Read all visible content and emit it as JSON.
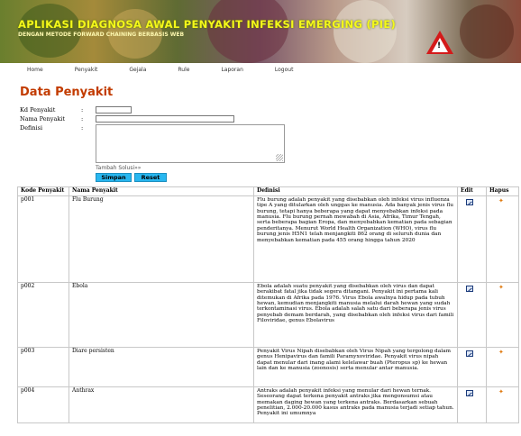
{
  "banner": {
    "title": "APLIKASI DIAGNOSA AWAL PENYAKIT INFEKSI EMERGING (PIE)",
    "subtitle": "DENGAN METODE FORWARD CHAINING BERBASIS WEB"
  },
  "nav": [
    {
      "label": "Home"
    },
    {
      "label": "Penyakit"
    },
    {
      "label": "Gejala"
    },
    {
      "label": "Rule"
    },
    {
      "label": "Laporan"
    },
    {
      "label": "Logout"
    }
  ],
  "page_title": "Data Penyakit",
  "form": {
    "kd_label": "Kd Penyakit",
    "nama_label": "Nama Penyakit",
    "definisi_label": "Definisi",
    "colon": ":",
    "kd_value": "",
    "nama_value": "",
    "definisi_value": "",
    "tambah_solusi": "Tambah Solusi»»",
    "simpan": "Simpan",
    "reset": "Reset"
  },
  "table": {
    "headers": {
      "kode": "Kode Penyakit",
      "nama": "Nama Penyakit",
      "definisi": "Definisi",
      "edit": "Edit",
      "hapus": "Hapus"
    },
    "rows": [
      {
        "kode": "p001",
        "nama": "Flu Burung",
        "definisi": "Flu burung adalah penyakit yang disebabkan oleh infeksi virus influenza tipe A yang ditularkan oleh unggas ke manusia. Ada banyak jenis virus flu burung, tetapi hanya beberapa yang dapat menyebabkan infeksi pada manusia. Flu burung pernah mewabah di Asia, Afrika, Timur Tengah, serta beberapa bagian Eropa, dan menyebabkan kematian pada sebagian penderitanya. Menurut World Health Organization (WHO), virus flu burung jenis H5N1 telah menjangkiti 862 orang di seluruh dunia dan menyebabkan kematian pada 455 orang hingga tahun 2020"
      },
      {
        "kode": "p002",
        "nama": "Ebola",
        "definisi": "Ebola adalah suatu penyakit yang disebabkan oleh virus dan dapat berakibat fatal jika tidak segera ditangani. Penyakit ini pertama kali ditemukan di Afrika pada 1976. Virus Ebola awalnya hidup pada tubuh hewan, kemudian menjangkiti manusia melalui darah hewan yang sudah terkontaminasi virus. Ebola adalah salah satu dari beberapa jenis virus penyebab demam berdarah, yang disebabkan oleh infeksi virus dari famili Filoviridae, genus Ebolavirus"
      },
      {
        "kode": "p003",
        "nama": "Diare persisten",
        "definisi": "Penyakit Virus Nipah disebabkan oleh Virus Nipah yang tergolong dalam genus Henipavirus dan famili Paramyxoviridae. Penyakit virus nipah dapat menular dari inang alami kelelawar buah (Pteropus sp) ke hewan lain dan ke manusia (zoonosis) serta menular antar manusia."
      },
      {
        "kode": "p004",
        "nama": "Anthrax",
        "definisi": "Antraks adalah penyakit infeksi yang menular dari hewan ternak. Seseorang dapat terkena penyakit antraks jika mengonsumsi atau memakan daging hewan yang terkena antraks. Berdasarkan sebuah penelitian, 2.000-20.000 kasus antraks pada manusia terjadi setiap tahun. Penyakit ini umumnya"
      }
    ]
  },
  "icons": {
    "edit": "edit-icon",
    "hapus": "delete-icon",
    "warning": "warning-triangle-icon"
  },
  "colors": {
    "title_accent": "#c23b00",
    "button": "#28b7f0",
    "banner_text": "#f4f81a"
  }
}
